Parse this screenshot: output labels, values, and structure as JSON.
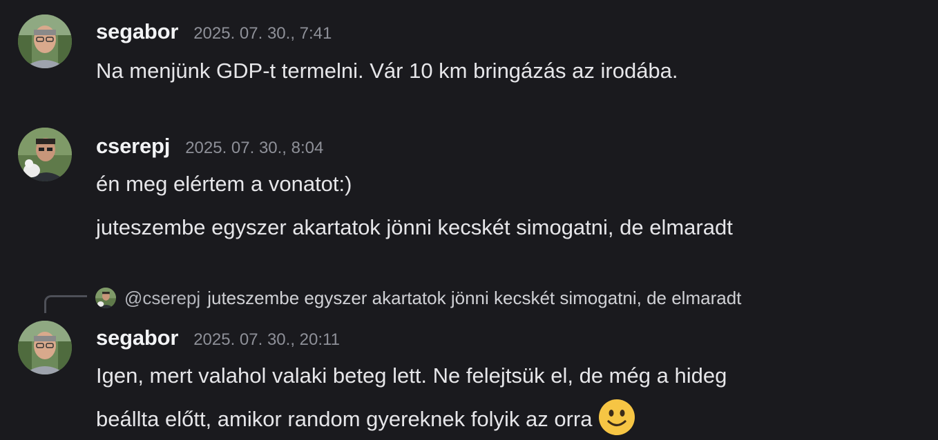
{
  "messages": [
    {
      "author": "segabor",
      "timestamp": "2025. 07. 30., 7:41",
      "avatar_icon": "user-avatar-segabor",
      "lines": [
        "Na menjünk GDP-t termelni. Vár 10 km bringázás az irodába."
      ]
    },
    {
      "author": "cserepj",
      "timestamp": "2025. 07. 30., 8:04",
      "avatar_icon": "user-avatar-cserepj",
      "lines": [
        "én meg elértem a vonatot:)",
        "juteszembe egyszer akartatok jönni kecskét simogatni, de elmaradt"
      ]
    },
    {
      "reply": {
        "mention": "@cserepj",
        "text": "juteszembe egyszer akartatok jönni kecskét simogatni, de elmaradt"
      },
      "author": "segabor",
      "timestamp": "2025. 07. 30., 20:11",
      "avatar_icon": "user-avatar-segabor",
      "lines": [
        "Igen, mert valahol valaki beteg lett. Ne felejtsük el, de még a hideg",
        "beállta előtt, amikor random gyereknek folyik az orra"
      ],
      "emoji": "slightly-smiling-face-icon"
    }
  ],
  "colors": {
    "background": "#1a1a1e",
    "username": "#f2f3f5",
    "timestamp": "#8e9098",
    "text": "#e6e6e9",
    "reply_line": "#4e5058"
  }
}
